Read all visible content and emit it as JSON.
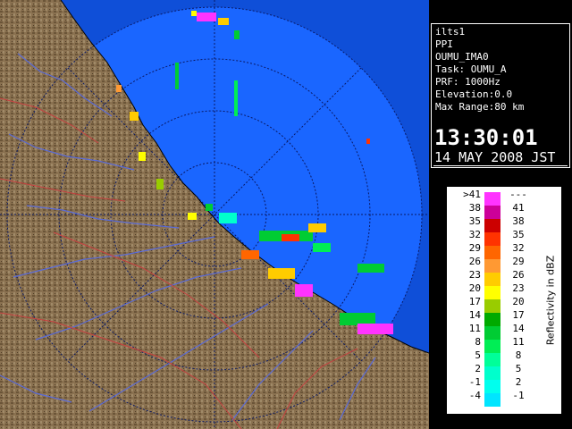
{
  "info": {
    "site": "ilts1",
    "mode": "PPI",
    "product": "OUMU_IMA0",
    "task": "Task: OUMU_A",
    "prf": "PRF: 1000Hz",
    "elevation": "Elevation:0.0",
    "max_range": "Max Range:80 km",
    "time": "13:30:01",
    "date": "14 MAY 2008 JST"
  },
  "legend": {
    "unit_label": "Reflectivity in dBZ",
    "rows": [
      {
        "low": ">41",
        "high": "---",
        "color": "#ff33ff"
      },
      {
        "low": "38",
        "high": "41",
        "color": "#cc0099"
      },
      {
        "low": "35",
        "high": "38",
        "color": "#cc0000"
      },
      {
        "low": "32",
        "high": "35",
        "color": "#ff3300"
      },
      {
        "low": "29",
        "high": "32",
        "color": "#ff6600"
      },
      {
        "low": "26",
        "high": "29",
        "color": "#ff9933"
      },
      {
        "low": "23",
        "high": "26",
        "color": "#ffcc00"
      },
      {
        "low": "20",
        "high": "23",
        "color": "#ffff00"
      },
      {
        "low": "17",
        "high": "20",
        "color": "#99cc00"
      },
      {
        "low": "14",
        "high": "17",
        "color": "#00aa00"
      },
      {
        "low": "11",
        "high": "14",
        "color": "#00cc33"
      },
      {
        "low": "8",
        "high": "11",
        "color": "#00ee55"
      },
      {
        "low": "5",
        "high": "8",
        "color": "#00ff99"
      },
      {
        "low": "2",
        "high": "5",
        "color": "#00ffcc"
      },
      {
        "low": "-1",
        "high": "2",
        "color": "#00ffee"
      },
      {
        "low": "-4",
        "high": "-1",
        "color": "#00e5ff"
      }
    ]
  },
  "map_colors": {
    "ocean": "#1a66ff",
    "ocean_outer": "#0f4fd8",
    "land": "#8a7150",
    "rivers": "#5a6bd8",
    "boundaries": "#c84040",
    "range_rings": "#0a1a66"
  }
}
